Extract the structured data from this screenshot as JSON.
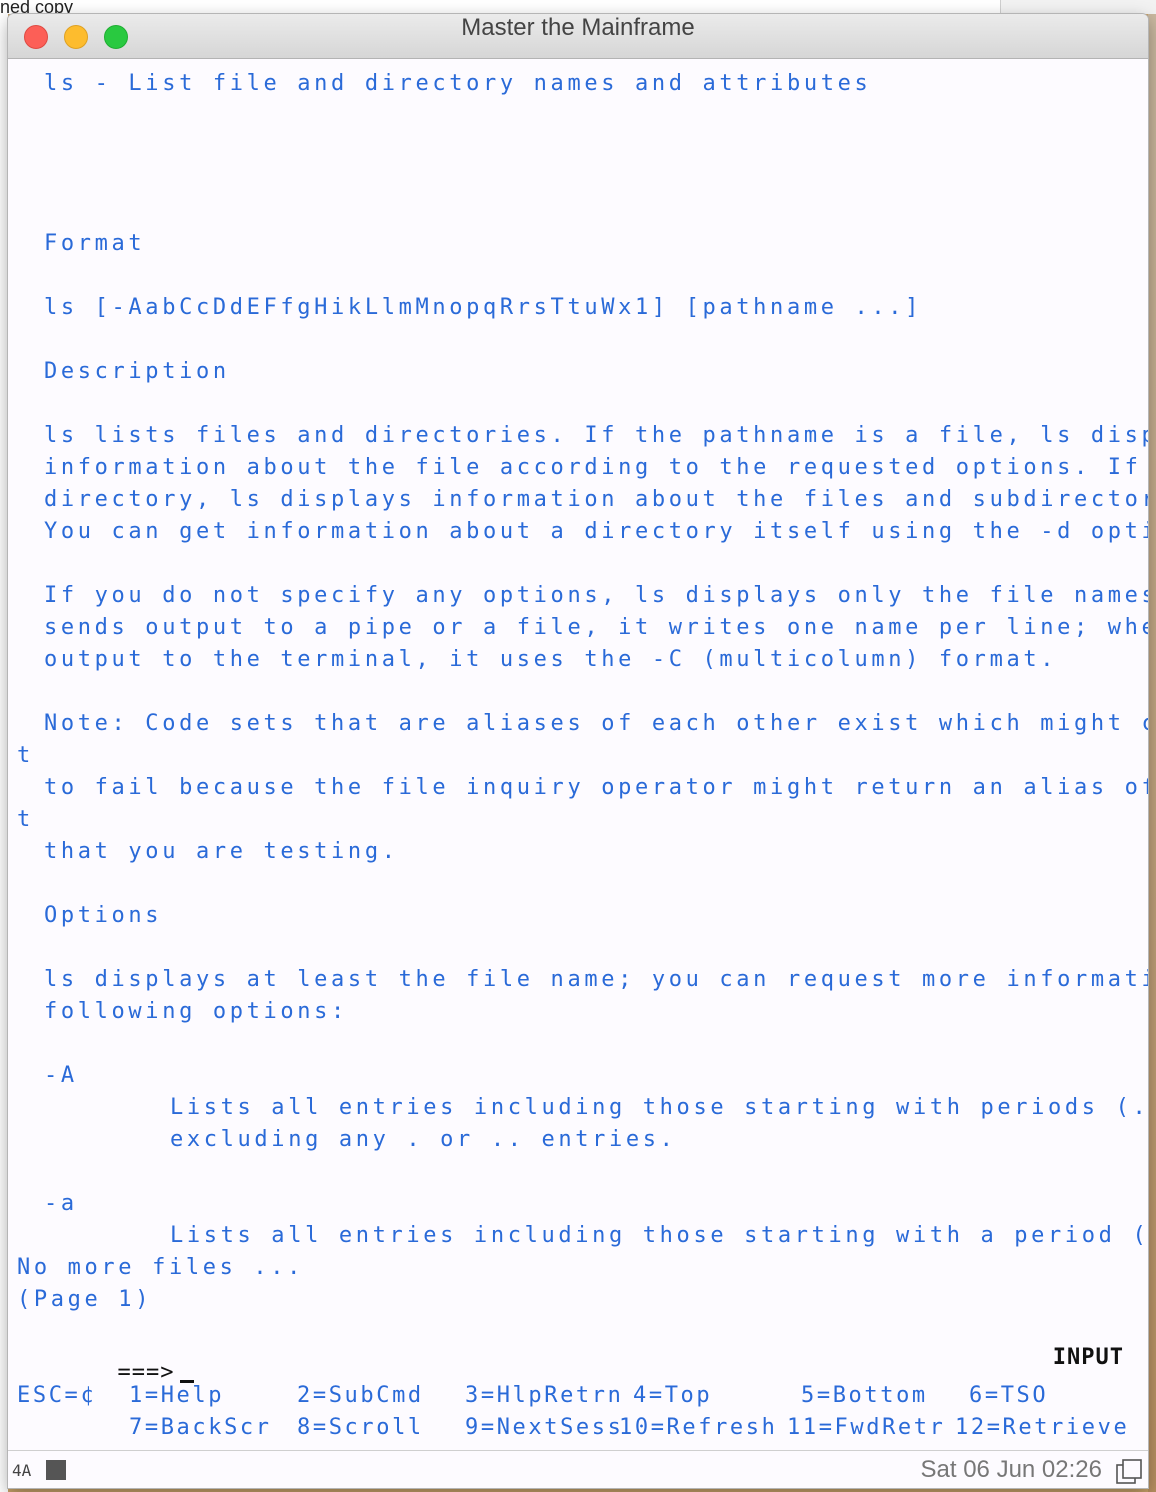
{
  "window": {
    "title": "Master the Mainframe",
    "fragment_left": "ned copy"
  },
  "content_lines": [
    {
      "text": "ls - List file and directory names and attributes",
      "col": 1,
      "row": 1
    },
    {
      "text": "Format",
      "col": 1,
      "row": 6
    },
    {
      "text": "ls [-AabCcDdEFfgHikLlmMnopqRrsTtuWx1] [pathname ...]",
      "col": 1,
      "row": 8
    },
    {
      "text": "Description",
      "col": 1,
      "row": 10
    },
    {
      "text": "ls lists files and directories. If the pathname is a file, ls displays",
      "col": 1,
      "row": 12
    },
    {
      "text": "information about the file according to the requested options. If it is a",
      "col": 1,
      "row": 13
    },
    {
      "text": "directory, ls displays information about the files and subdirectories therein.",
      "col": 1,
      "row": 14
    },
    {
      "text": "You can get information about a directory itself using the -d option.",
      "col": 1,
      "row": 15
    },
    {
      "text": "If you do not specify any options, ls displays only the file names. When ls",
      "col": 1,
      "row": 17
    },
    {
      "text": "sends output to a pipe or a file, it writes one name per line; when it sends",
      "col": 1,
      "row": 18
    },
    {
      "text": "output to the terminal, it uses the -C (multicolumn) format.",
      "col": 1,
      "row": 19
    },
    {
      "text": "Note: Code sets that are aliases of each other exist which might cause the tes",
      "col": 1,
      "row": 21
    },
    {
      "text": "t",
      "col": 0,
      "row": 22
    },
    {
      "text": "to fail because the file inquiry operator might return an alias of the code se",
      "col": 1,
      "row": 23
    },
    {
      "text": "t",
      "col": 0,
      "row": 24
    },
    {
      "text": "that you are testing.",
      "col": 1,
      "row": 25
    },
    {
      "text": "Options",
      "col": 1,
      "row": 27
    },
    {
      "text": "ls displays at least the file name; you can request more information with the",
      "col": 1,
      "row": 29
    },
    {
      "text": "following options:",
      "col": 1,
      "row": 30
    },
    {
      "text": "-A",
      "col": 1,
      "row": 32
    },
    {
      "text": "Lists all entries including those starting with periods (.); but",
      "col": 6,
      "row": 33
    },
    {
      "text": "excluding any . or .. entries.",
      "col": 6,
      "row": 34
    },
    {
      "text": "-a",
      "col": 1,
      "row": 36
    },
    {
      "text": "Lists all entries including those starting with a period (.).",
      "col": 6,
      "row": 37
    },
    {
      "text": "No more files ...",
      "col": 0,
      "row": 38
    },
    {
      "text": "(Page 1)",
      "col": 0,
      "row": 39
    }
  ],
  "prompt": {
    "label": "===>"
  },
  "mode_indicator": "INPUT",
  "pf_keys": {
    "row1": [
      "ESC=¢",
      "1=Help",
      "2=SubCmd",
      "3=HlpRetrn",
      "4=Top",
      "5=Bottom",
      "6=TSO"
    ],
    "row2": [
      "7=BackScr",
      "8=Scroll",
      "9=NextSess",
      "10=Refresh",
      "11=FwdRetr",
      "12=Retrieve"
    ]
  },
  "status": {
    "oia": "4A",
    "datetime": "Sat 06 Jun 02:26"
  },
  "colors": {
    "terminal_text": "#2a6ad8",
    "terminal_bg": "#fdfbff"
  }
}
